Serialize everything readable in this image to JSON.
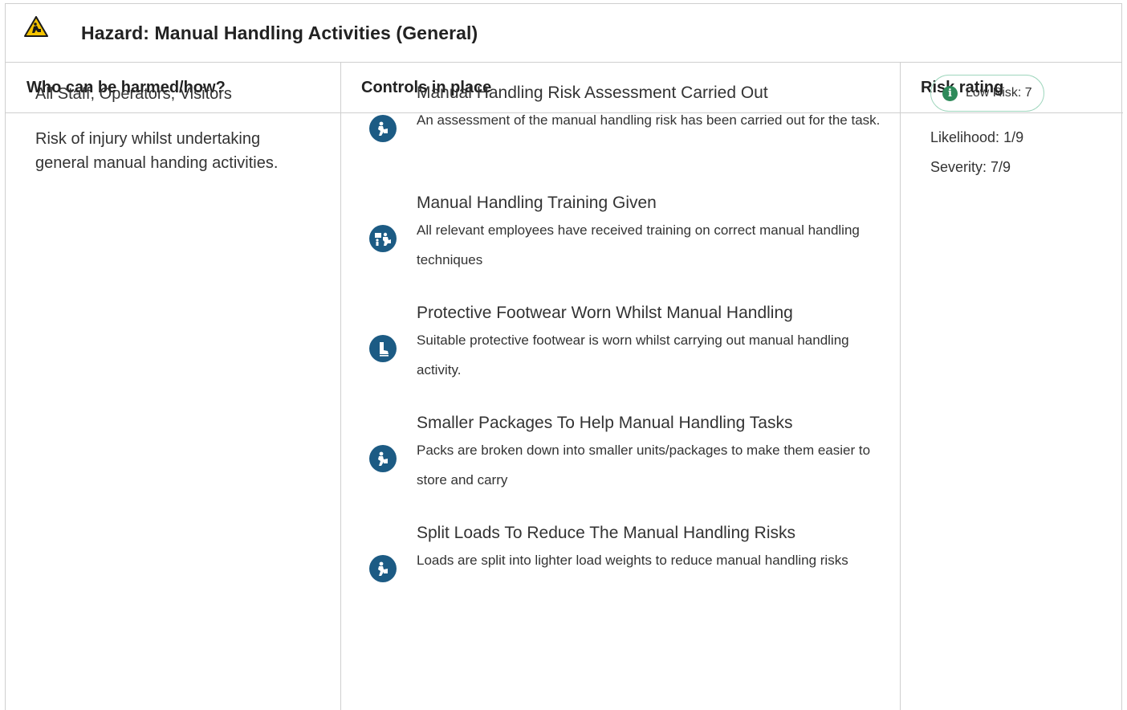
{
  "hazard": {
    "label": "Hazard:",
    "name": "Manual Handling Activities (General)",
    "title": "Hazard:  Manual Handling Activities (General)",
    "icon": "manual-handling-warning-icon"
  },
  "columns": {
    "who": "Who can be harmed/how?",
    "controls": "Controls in place",
    "risk": "Risk rating"
  },
  "who": {
    "people": "All Staff, Operators, Visitors",
    "how": "Risk of injury whilst undertaking general manual handing activities."
  },
  "controls": [
    {
      "title": "Manual Handling Risk Assessment Carried Out",
      "description": "An assessment of the manual handling risk has been carried out for the task.",
      "icon": "manual-handling-icon"
    },
    {
      "title": "Manual Handling Training Given",
      "description": "All relevant employees have received training on correct manual handling techniques",
      "icon": "training-icon"
    },
    {
      "title": "Protective Footwear Worn Whilst Manual Handling",
      "description": "Suitable protective footwear is worn whilst carrying out manual handling activity.",
      "icon": "safety-boot-icon"
    },
    {
      "title": "Smaller Packages To Help Manual Handling Tasks",
      "description": "Packs are broken down into smaller units/packages to make them easier to store and carry",
      "icon": "manual-handling-icon"
    },
    {
      "title": "Split Loads To Reduce The Manual Handling Risks",
      "description": "Loads are split into lighter load weights to reduce manual handling risks",
      "icon": "manual-handling-icon"
    }
  ],
  "risk": {
    "badge": "Low Risk: 7",
    "likelihood": "Likelihood: 1/9",
    "severity": "Severity: 7/9",
    "badge_color": "#2e8a5a",
    "icon": "info-icon"
  },
  "colors": {
    "icon_blue": "#1c5b84",
    "hazard_yellow": "#f5c400",
    "border": "#cfcfcf"
  }
}
